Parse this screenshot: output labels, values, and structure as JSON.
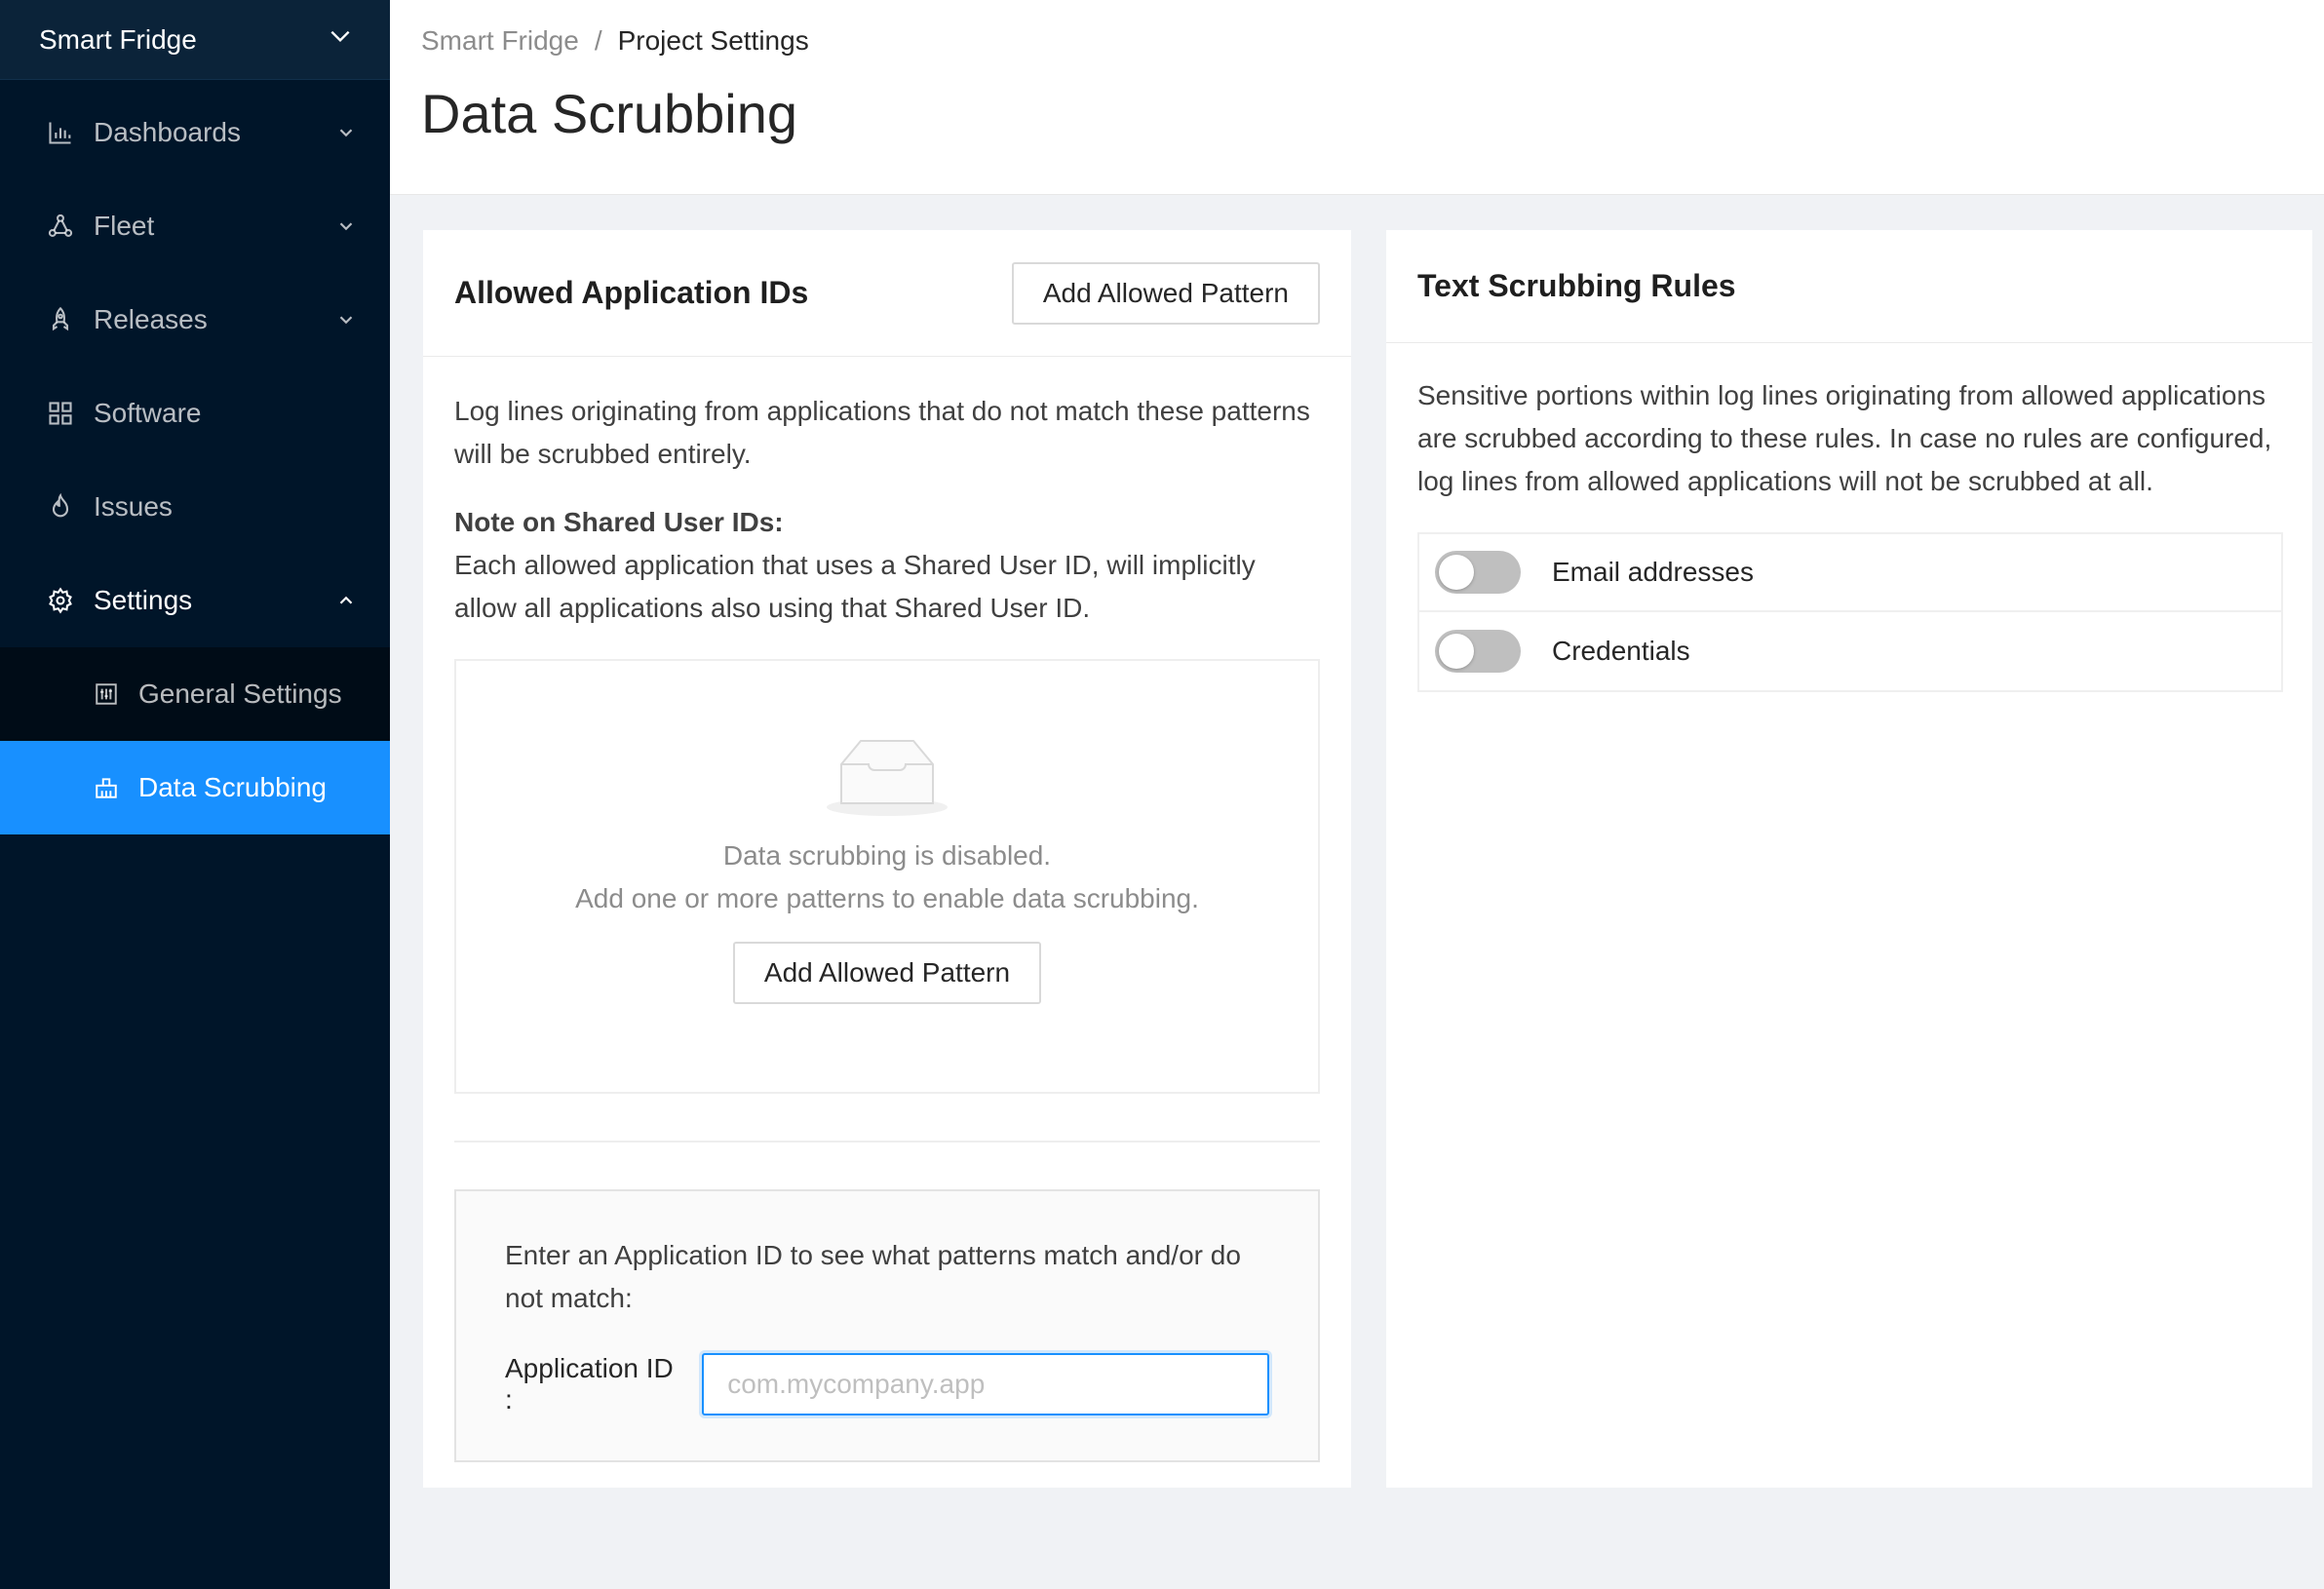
{
  "sidebar": {
    "project_name": "Smart Fridge",
    "items": [
      {
        "label": "Dashboards",
        "icon": "bar-chart-icon"
      },
      {
        "label": "Fleet",
        "icon": "nodes-icon"
      },
      {
        "label": "Releases",
        "icon": "rocket-icon"
      },
      {
        "label": "Software",
        "icon": "grid-icon"
      },
      {
        "label": "Issues",
        "icon": "fire-icon"
      },
      {
        "label": "Settings",
        "icon": "gear-icon"
      }
    ],
    "settings_sub": [
      {
        "label": "General Settings",
        "icon": "sliders-icon"
      },
      {
        "label": "Data Scrubbing",
        "icon": "scrub-icon"
      }
    ]
  },
  "header": {
    "breadcrumb": [
      "Smart Fridge",
      "Project Settings"
    ],
    "separator": "/",
    "title": "Data Scrubbing"
  },
  "allowed": {
    "title": "Allowed Application IDs",
    "add_button": "Add Allowed Pattern",
    "description": "Log lines originating from applications that do not match these patterns will be scrubbed entirely.",
    "note_title": "Note on Shared User IDs:",
    "note_text": "Each allowed application that uses a Shared User ID, will implicitly allow all applications also using that Shared User ID.",
    "empty_line1": "Data scrubbing is disabled.",
    "empty_line2": "Add one or more patterns to enable data scrubbing.",
    "empty_button": "Add Allowed Pattern",
    "tester_text": "Enter an Application ID to see what patterns match and/or do not match:",
    "input_label": "Application ID",
    "input_colon": ":",
    "input_placeholder": "com.mycompany.app",
    "input_value": ""
  },
  "rules": {
    "title": "Text Scrubbing Rules",
    "description": "Sensitive portions within log lines originating from allowed applications are scrubbed according to these rules. In case no rules are configured, log lines from allowed applications will not be scrubbed at all.",
    "items": [
      {
        "label": "Email addresses",
        "enabled": false
      },
      {
        "label": "Credentials",
        "enabled": false
      }
    ]
  },
  "colors": {
    "sidebar_bg": "#001529",
    "selected": "#1890ff",
    "switch_off": "#bfbfbf"
  }
}
